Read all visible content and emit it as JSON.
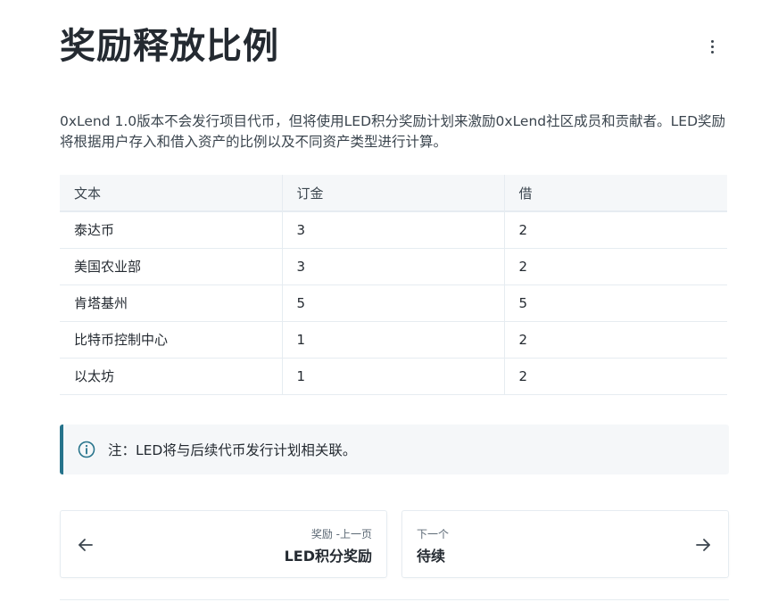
{
  "page": {
    "title": "奖励释放比例",
    "intro": "0xLend 1.0版本不会发行项目代币，但将使用LED积分奖励计划来激励0xLend社区成员和贡献者。LED奖励将根据用户存入和借入资产的比例以及不同资产类型进行计算。"
  },
  "table": {
    "headers": [
      "文本",
      "订金",
      "借"
    ],
    "rows": [
      [
        "泰达币",
        "3",
        "2"
      ],
      [
        "美国农业部",
        "3",
        "2"
      ],
      [
        "肯塔基州",
        "5",
        "5"
      ],
      [
        "比特币控制中心",
        "1",
        "2"
      ],
      [
        "以太坊",
        "1",
        "2"
      ]
    ]
  },
  "hint": {
    "icon": "info-icon",
    "text": "注：LED将与后续代币发行计划相关联。",
    "accent_color": "#26738b"
  },
  "navigation": {
    "prev": {
      "small": "奖励 -上一页",
      "label": "LED积分奖励",
      "icon": "arrow-left-icon"
    },
    "next": {
      "small": "下一个",
      "label": "待续",
      "icon": "arrow-right-icon"
    }
  },
  "menu": {
    "icon": "more-vertical-icon"
  }
}
